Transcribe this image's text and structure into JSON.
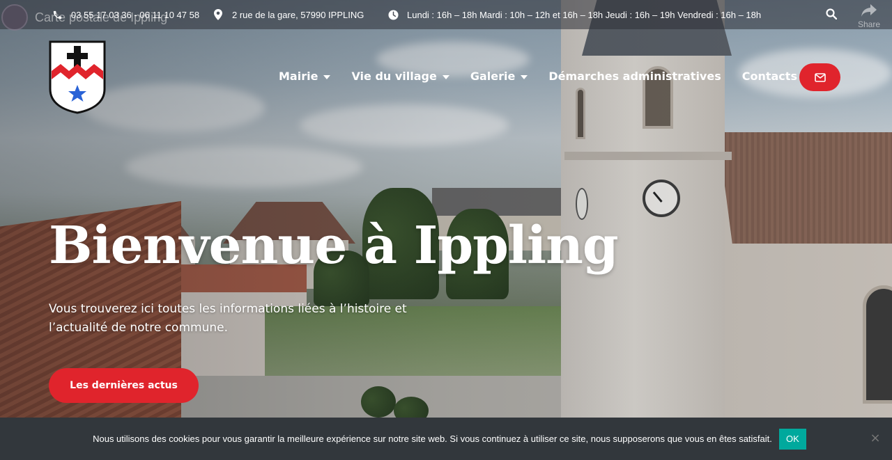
{
  "video_overlay": {
    "title": "Carte postale de Ippling",
    "share_label": "Share"
  },
  "topbar": {
    "phone": "03 55 17 03 36 - 06 11 10 47 58",
    "address": "2 rue de la gare, 57990 IPPLING",
    "hours": "Lundi : 16h – 18h Mardi : 10h – 12h et 16h – 18h Jeudi : 16h – 19h Vendredi : 16h – 18h",
    "icons": [
      "phone-icon",
      "map-pin-icon",
      "clock-icon",
      "search-icon",
      "share-icon"
    ]
  },
  "nav": {
    "items": [
      {
        "label": "Mairie",
        "has_dropdown": true
      },
      {
        "label": "Vie du village",
        "has_dropdown": true
      },
      {
        "label": "Galerie",
        "has_dropdown": true
      },
      {
        "label": "Démarches administratives",
        "has_dropdown": false
      },
      {
        "label": "Contacts",
        "has_dropdown": true
      }
    ],
    "mail_icon": "envelope-icon"
  },
  "hero": {
    "title": "Bienvenue à Ippling",
    "subtitle": "Vous trouverez ici toutes les informations liées à l’histoire et l’actualité de notre commune.",
    "cta_label": "Les dernières actus"
  },
  "cookie_bar": {
    "text": "Nous utilisons des cookies pour vous garantir la meilleure expérience sur notre site web. Si vous continuez à utiliser ce site, nous supposerons que vous en êtes satisfait.",
    "ok_label": "OK",
    "close_symbol": "×"
  },
  "colors": {
    "accent_red": "#e0242c",
    "cookie_ok": "#00a99d",
    "cookie_bg": "#32373c"
  }
}
